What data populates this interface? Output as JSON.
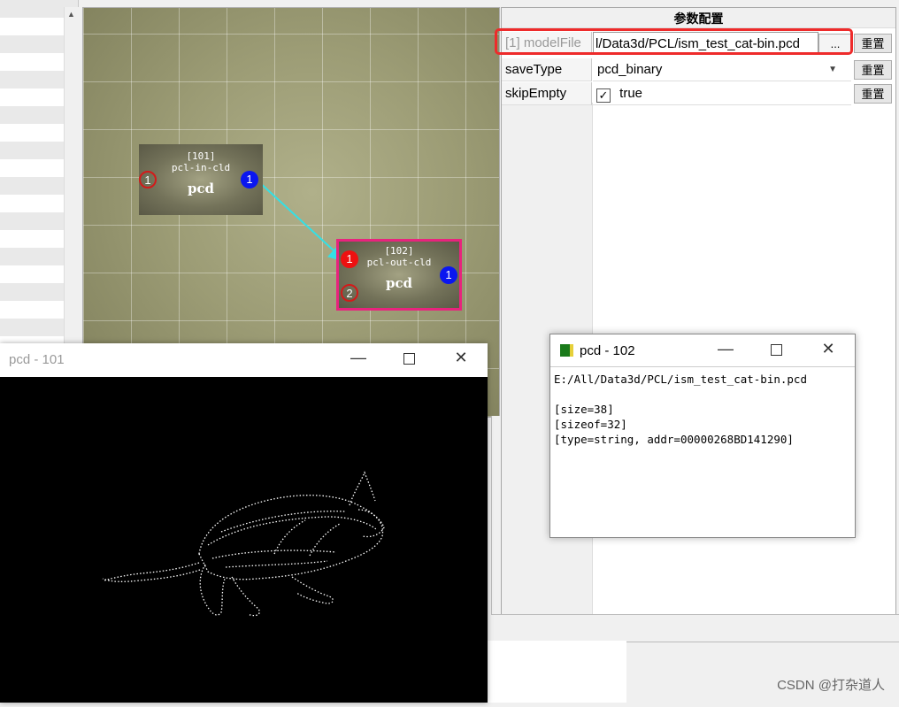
{
  "canvas": {
    "nodes": [
      {
        "id": "[101]",
        "name": "pcl-in-cld",
        "type": "pcd",
        "in_ports": [
          "1"
        ],
        "out_ports": [
          "1"
        ]
      },
      {
        "id": "[102]",
        "name": "pcl-out-cld",
        "type": "pcd",
        "in_ports": [
          "1",
          "2"
        ],
        "out_ports": [
          "1"
        ]
      }
    ]
  },
  "panel": {
    "title": "参数配置",
    "rows": [
      {
        "name": "[1] modelFile",
        "value": "l/Data3d/PCL/ism_test_cat-bin.pcd",
        "browse_label": "...",
        "reset_label": "重置"
      },
      {
        "name": "saveType",
        "value": "pcd_binary",
        "reset_label": "重置"
      },
      {
        "name": "skipEmpty",
        "check": "✓",
        "value": "true",
        "reset_label": "重置"
      }
    ]
  },
  "viewer": {
    "title": "pcd - 101"
  },
  "info": {
    "title": "pcd - 102",
    "lines": [
      "E:/All/Data3d/PCL/ism_test_cat-bin.pcd",
      "",
      "[size=38]",
      "[sizeof=32]",
      "[type=string, addr=00000268BD141290]"
    ]
  },
  "watermark": "CSDN @打杂道人",
  "colors": {
    "canvas_bg": "#9b9b74",
    "connection": "#33e0e6",
    "selected_border": "#e8237d",
    "out_port": "#0a16f0",
    "in_port": "#d31a1a",
    "highlight": "#ee2b2b"
  }
}
